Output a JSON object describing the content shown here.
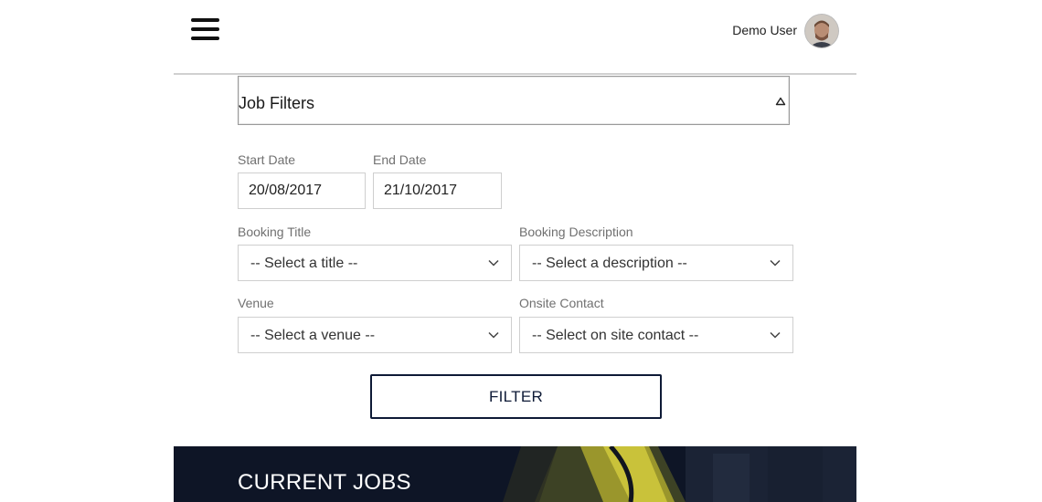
{
  "header": {
    "user_name": "Demo User"
  },
  "filters": {
    "panel_title": "Job Filters",
    "start_date": {
      "label": "Start Date",
      "value": "20/08/2017"
    },
    "end_date": {
      "label": "End Date",
      "value": "21/10/2017"
    },
    "booking_title": {
      "label": "Booking Title",
      "value": "-- Select a title --"
    },
    "booking_description": {
      "label": "Booking Description",
      "value": "-- Select a description --"
    },
    "venue": {
      "label": "Venue",
      "value": "-- Select a venue --"
    },
    "onsite_contact": {
      "label": "Onsite Contact",
      "value": "-- Select on site contact --"
    },
    "filter_button": "FILTER"
  },
  "jobs": {
    "title": "CURRENT JOBS"
  },
  "colors": {
    "button_border": "#0e1a36",
    "banner_bg": "#0e1526",
    "banner_accent": "#c9c23a"
  }
}
